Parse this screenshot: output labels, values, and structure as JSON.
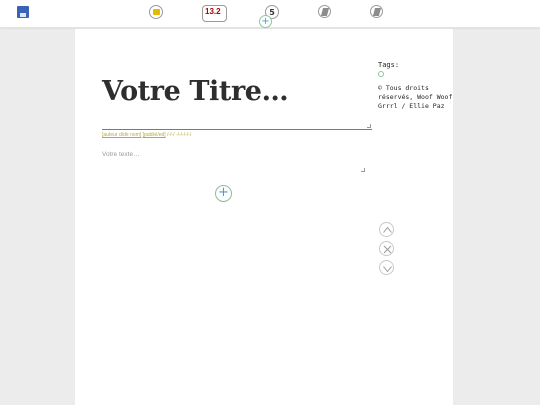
{
  "toolbar": {
    "size_value": "13.2",
    "layout_label": "5",
    "add_label": "+"
  },
  "editor": {
    "title": "Votre Titre…",
    "author_label": "[auteur d/de nom]",
    "published_label": "[publié/ed]",
    "date_placeholder": "/-/-/ -/-/-/-/-/",
    "body_placeholder": "Votre texte…",
    "add_block_label": "+"
  },
  "sidebar": {
    "tags_label": "Tags:",
    "copyright": "© Tous droits réservés, Woof Woof Grrrl / Ellie Paz"
  },
  "colors": {
    "accent_add": "#4b9bd0",
    "accent_ring": "#7fc29a",
    "meta_text": "#b9a93a",
    "save_icon": "#3a63b8"
  }
}
